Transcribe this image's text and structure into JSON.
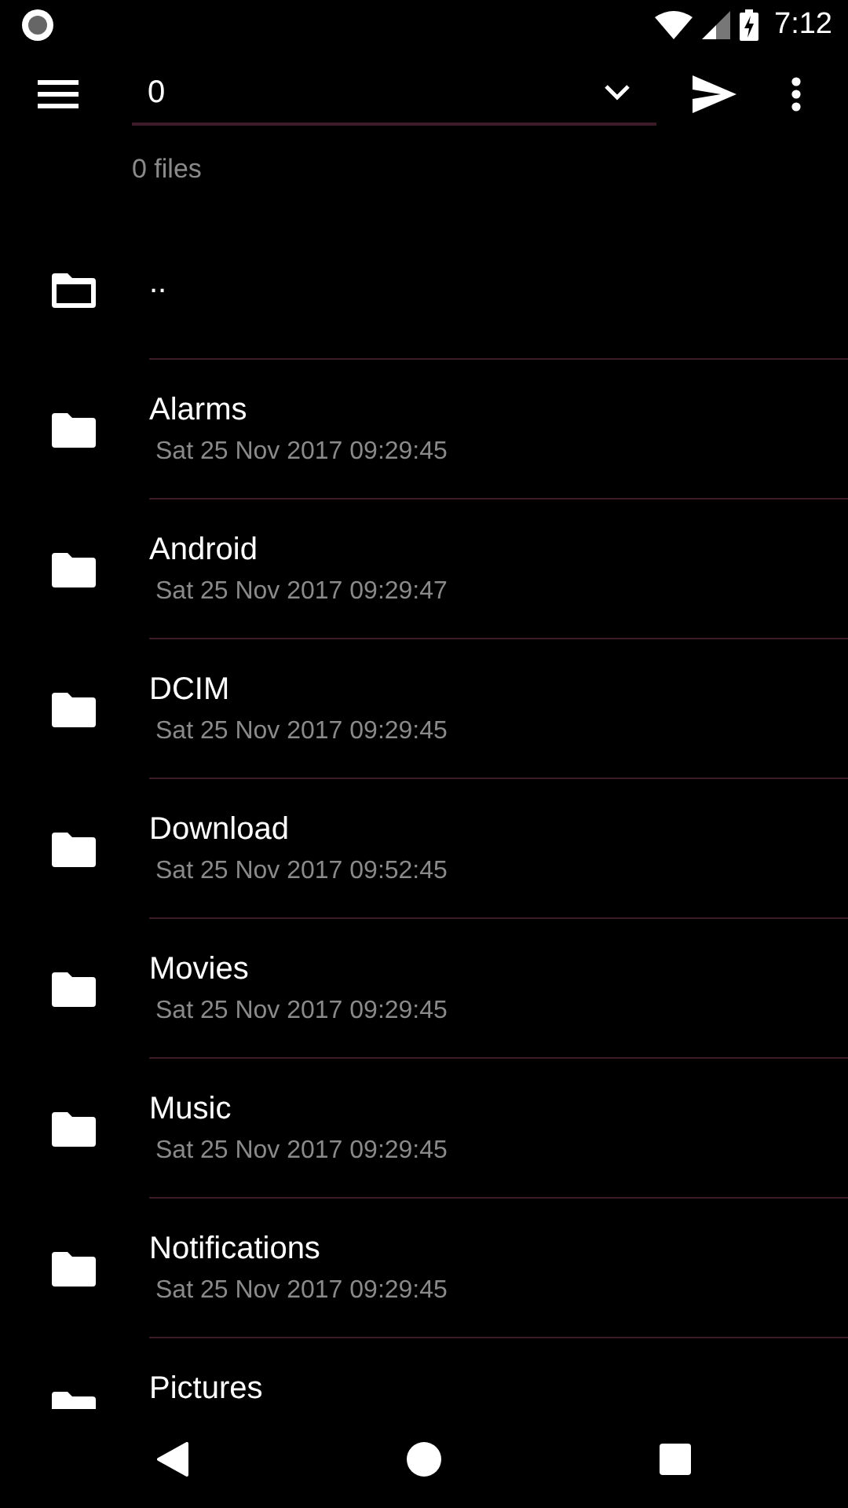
{
  "status_bar": {
    "time": "7:12"
  },
  "toolbar": {
    "path_value": "0"
  },
  "summary": "0 files",
  "entries": [
    {
      "kind": "parent",
      "name": ".."
    },
    {
      "kind": "folder",
      "name": "Alarms",
      "date": "Sat 25 Nov 2017 09:29:45"
    },
    {
      "kind": "folder",
      "name": "Android",
      "date": "Sat 25 Nov 2017 09:29:47"
    },
    {
      "kind": "folder",
      "name": "DCIM",
      "date": "Sat 25 Nov 2017 09:29:45"
    },
    {
      "kind": "folder",
      "name": "Download",
      "date": "Sat 25 Nov 2017 09:52:45"
    },
    {
      "kind": "folder",
      "name": "Movies",
      "date": "Sat 25 Nov 2017 09:29:45"
    },
    {
      "kind": "folder",
      "name": "Music",
      "date": "Sat 25 Nov 2017 09:29:45"
    },
    {
      "kind": "folder",
      "name": "Notifications",
      "date": "Sat 25 Nov 2017 09:29:45"
    },
    {
      "kind": "folder",
      "name": "Pictures"
    }
  ]
}
